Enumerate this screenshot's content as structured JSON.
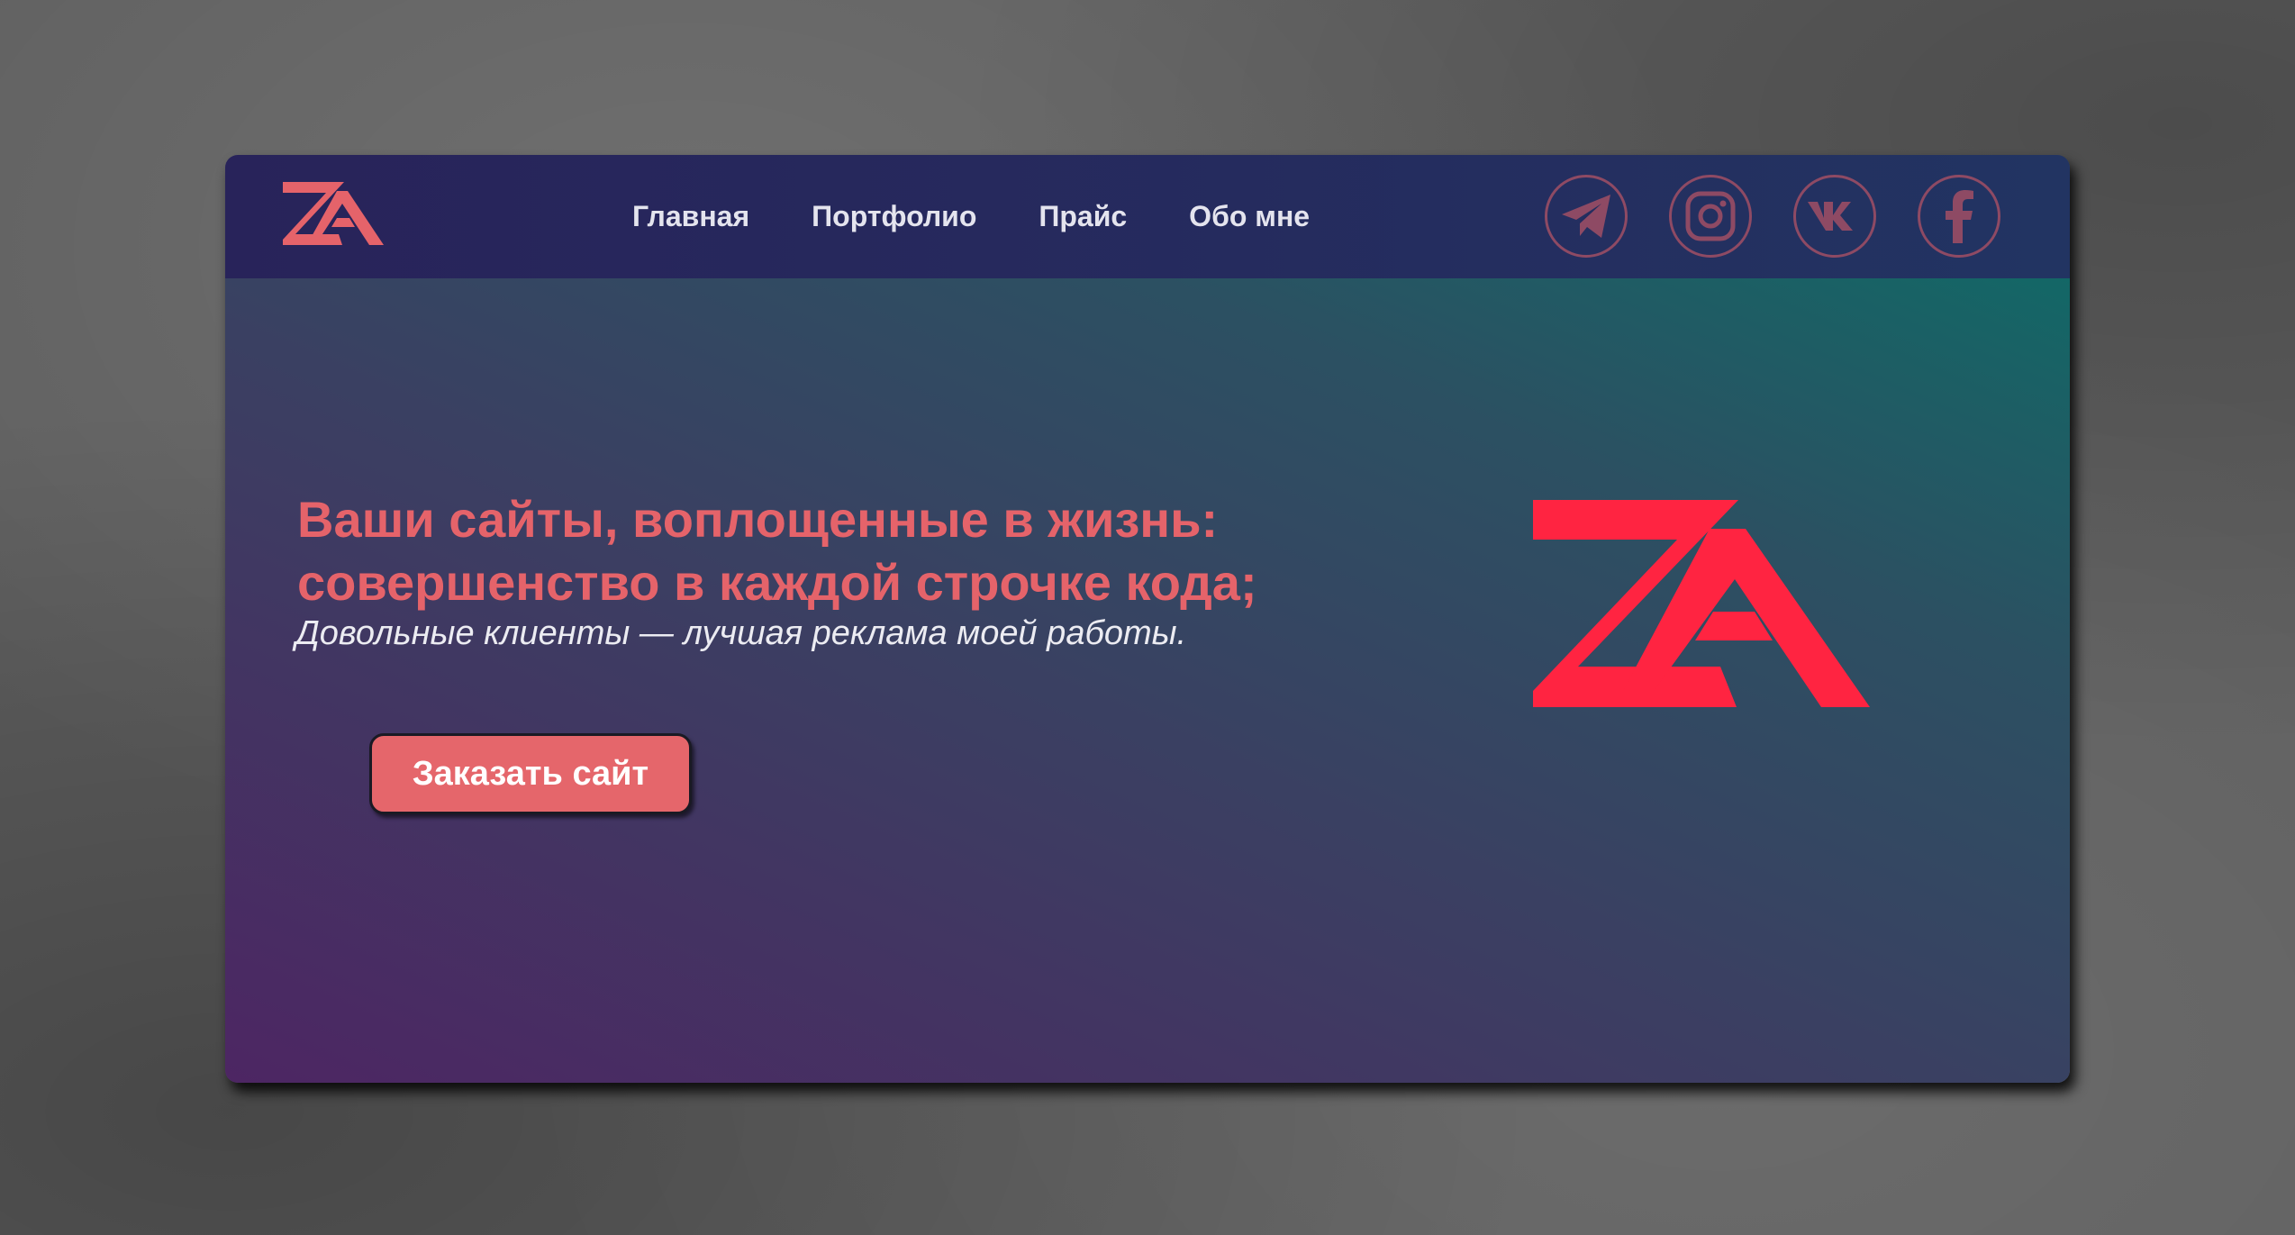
{
  "brand": {
    "logo_icon": "za-logo",
    "accent_color": "#e5636a",
    "logo_color_hero": "#ff2441"
  },
  "nav": {
    "items": [
      {
        "label": "Главная"
      },
      {
        "label": "Портфолио"
      },
      {
        "label": "Прайс"
      },
      {
        "label": "Обо мне"
      }
    ]
  },
  "socials": [
    {
      "icon": "telegram-icon"
    },
    {
      "icon": "instagram-icon"
    },
    {
      "icon": "vk-icon"
    },
    {
      "icon": "facebook-icon"
    }
  ],
  "hero": {
    "headline_line1": "Ваши сайты, воплощенные в жизнь:",
    "headline_line2": "совершенство в каждой строчке кода;",
    "subtitle": "Довольные клиенты — лучшая реклама моей работы.",
    "cta_label": "Заказать сайт"
  }
}
